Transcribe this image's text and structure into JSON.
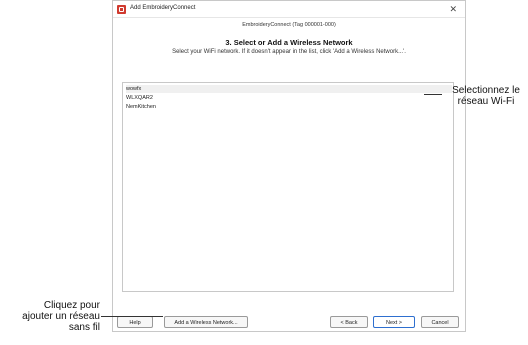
{
  "window": {
    "title": "Add EmbroideryConnect",
    "close_glyph": "✕"
  },
  "header": {
    "tag_line": "EmbroideryConnect (Tag 000001-000)",
    "step_title": "3. Select or Add a Wireless Network",
    "instruction": "Select your WiFi network. If it doesn't appear in the list, click 'Add a Wireless Network...'."
  },
  "networks": {
    "items": [
      "wowfx",
      "WLXQAR2",
      "NemKitchen"
    ],
    "selected_index": 0
  },
  "buttons": {
    "help": "Help",
    "add_network": "Add a Wireless Network...",
    "back": "< Back",
    "next": "Next >",
    "cancel": "Cancel"
  },
  "callouts": {
    "select_line1": "Selectionnez le",
    "select_line2": "réseau Wi-Fi",
    "add_line1": "Cliquez pour",
    "add_line2": "ajouter un réseau",
    "add_line3": "sans fil"
  },
  "colors": {
    "accent": "#2e6fcf",
    "app_icon": "#d03a2f"
  }
}
